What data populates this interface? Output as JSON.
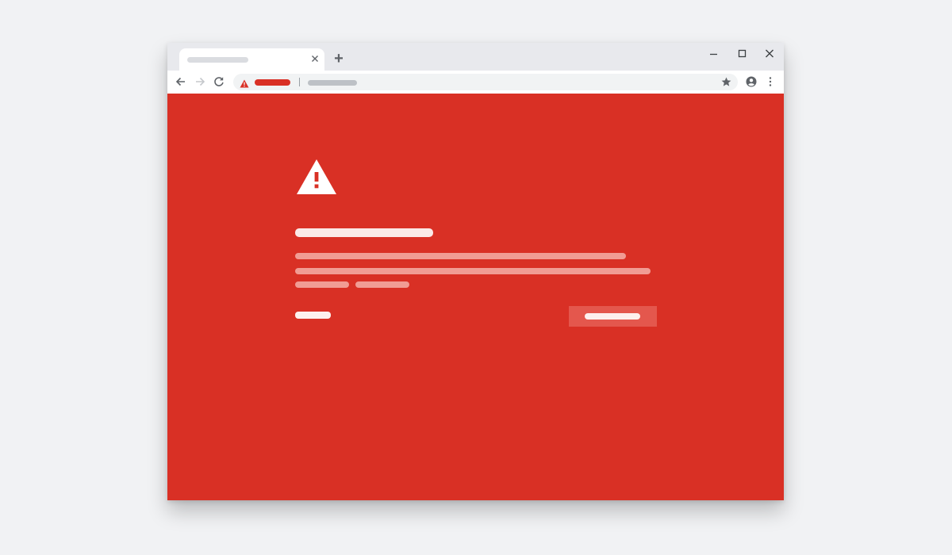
{
  "tabstrip": {
    "close_icon": "close-icon",
    "new_tab_glyph": "+"
  },
  "window_controls": {
    "icons": [
      "minimize-icon",
      "maximize-icon",
      "close-icon"
    ]
  },
  "toolbar": {
    "icons": [
      "back-arrow-icon",
      "forward-arrow-icon",
      "reload-icon",
      "star-icon",
      "profile-icon",
      "more-vert-icon"
    ],
    "forward_enabled": false
  },
  "omnibox": {
    "security_state": "dangerous",
    "security_icon": "warning-triangle-icon"
  },
  "interstitial": {
    "icon": "warning-triangle-icon",
    "background_color": "#d93025",
    "accent_color": "#d93025"
  },
  "colors": {
    "page_bg": "#f1f2f4",
    "tabstrip_bg": "#e8e9ed",
    "danger_red": "#d93025",
    "button_bg": "#e4574d"
  }
}
